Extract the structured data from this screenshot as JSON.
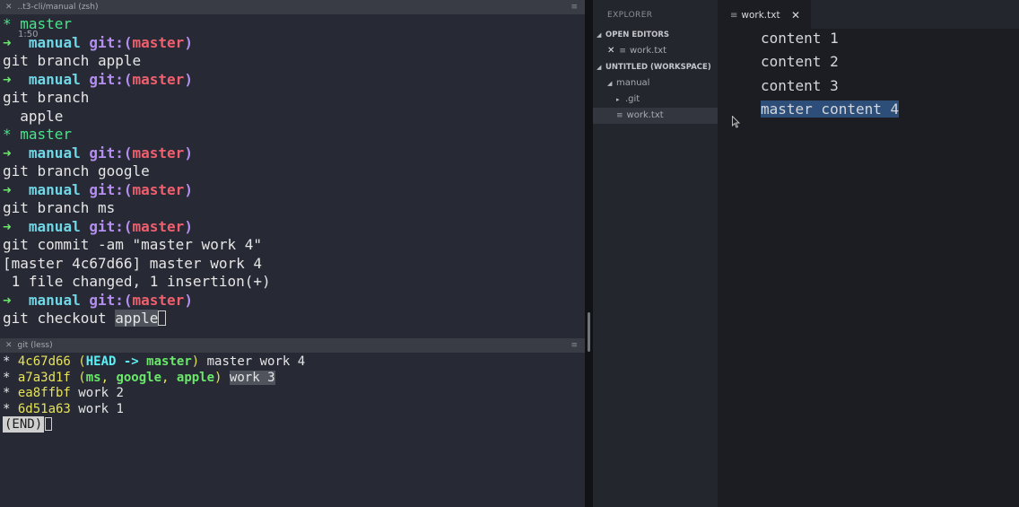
{
  "terminal_top": {
    "title": "..t3-cli/manual (zsh)",
    "time_overlay": "1:50",
    "lines": [
      [
        {
          "t": "* master",
          "c": "c-green"
        }
      ],
      [
        {
          "t": "➜  ",
          "c": "c-lime"
        },
        {
          "t": "manual ",
          "c": "c-cyan"
        },
        {
          "t": "git:(",
          "c": "c-purple"
        },
        {
          "t": "master",
          "c": "c-red"
        },
        {
          "t": ")",
          "c": "c-purple"
        }
      ],
      [
        {
          "t": "git branch apple",
          "c": ""
        }
      ],
      [
        {
          "t": "➜  ",
          "c": "c-lime"
        },
        {
          "t": "manual ",
          "c": "c-cyan"
        },
        {
          "t": "git:(",
          "c": "c-purple"
        },
        {
          "t": "master",
          "c": "c-red"
        },
        {
          "t": ")",
          "c": "c-purple"
        }
      ],
      [
        {
          "t": "git branch",
          "c": ""
        }
      ],
      [
        {
          "t": "  apple",
          "c": ""
        }
      ],
      [
        {
          "t": "* master",
          "c": "c-green"
        }
      ],
      [
        {
          "t": "➜  ",
          "c": "c-lime"
        },
        {
          "t": "manual ",
          "c": "c-cyan"
        },
        {
          "t": "git:(",
          "c": "c-purple"
        },
        {
          "t": "master",
          "c": "c-red"
        },
        {
          "t": ")",
          "c": "c-purple"
        }
      ],
      [
        {
          "t": "git branch google",
          "c": ""
        }
      ],
      [
        {
          "t": "➜  ",
          "c": "c-lime"
        },
        {
          "t": "manual ",
          "c": "c-cyan"
        },
        {
          "t": "git:(",
          "c": "c-purple"
        },
        {
          "t": "master",
          "c": "c-red"
        },
        {
          "t": ")",
          "c": "c-purple"
        }
      ],
      [
        {
          "t": "git branch ms",
          "c": ""
        }
      ],
      [
        {
          "t": "➜  ",
          "c": "c-lime"
        },
        {
          "t": "manual ",
          "c": "c-cyan"
        },
        {
          "t": "git:(",
          "c": "c-purple"
        },
        {
          "t": "master",
          "c": "c-red"
        },
        {
          "t": ")",
          "c": "c-purple"
        }
      ],
      [
        {
          "t": "git commit -am \"master work 4\"",
          "c": ""
        }
      ],
      [
        {
          "t": "[master 4c67d66] master work 4",
          "c": ""
        }
      ],
      [
        {
          "t": " 1 file changed, 1 insertion(+)",
          "c": ""
        }
      ],
      [
        {
          "t": "➜  ",
          "c": "c-lime"
        },
        {
          "t": "manual ",
          "c": "c-cyan"
        },
        {
          "t": "git:(",
          "c": "c-purple"
        },
        {
          "t": "master",
          "c": "c-red"
        },
        {
          "t": ")",
          "c": "c-purple"
        }
      ],
      [
        {
          "t": "git checkout ",
          "c": ""
        },
        {
          "t": "apple",
          "c": "sel-bg"
        },
        {
          "cursor": true
        }
      ]
    ]
  },
  "terminal_bottom": {
    "title": "git (less)",
    "lines": [
      [
        {
          "t": "* ",
          "c": ""
        },
        {
          "t": "4c67d66",
          "c": "c-yellow"
        },
        {
          "t": " (",
          "c": "c-yellow"
        },
        {
          "t": "HEAD -> ",
          "c": "c-bright"
        },
        {
          "t": "master",
          "c": "c-lime"
        },
        {
          "t": ")",
          "c": "c-yellow"
        },
        {
          "t": " master work 4",
          "c": ""
        }
      ],
      [
        {
          "t": "* ",
          "c": ""
        },
        {
          "t": "a7a3d1f",
          "c": "c-yellow"
        },
        {
          "t": " (",
          "c": "c-yellow"
        },
        {
          "t": "ms",
          "c": "c-lime"
        },
        {
          "t": ", ",
          "c": "c-yellow"
        },
        {
          "t": "google",
          "c": "c-lime"
        },
        {
          "t": ", ",
          "c": "c-yellow"
        },
        {
          "t": "apple",
          "c": "c-lime"
        },
        {
          "t": ")",
          "c": "c-yellow"
        },
        {
          "t": " ",
          "c": ""
        },
        {
          "t": "work 3",
          "c": "sel-bg"
        }
      ],
      [
        {
          "t": "* ",
          "c": ""
        },
        {
          "t": "ea8ffbf",
          "c": "c-yellow"
        },
        {
          "t": " work 2",
          "c": ""
        }
      ],
      [
        {
          "t": "* ",
          "c": ""
        },
        {
          "t": "6d51a63",
          "c": "c-yellow"
        },
        {
          "t": " work 1",
          "c": ""
        }
      ],
      [
        {
          "end": "(END)"
        }
      ]
    ]
  },
  "explorer": {
    "title": "EXPLORER",
    "open_editors_label": "OPEN EDITORS",
    "open_file": "work.txt",
    "workspace_label": "UNTITLED (WORKSPACE)",
    "folder": "manual",
    "subfolder": ".git",
    "file": "work.txt"
  },
  "editor": {
    "tab_label": "work.txt",
    "lines": [
      "content 1",
      "content 2",
      "content 3",
      "master content 4"
    ]
  },
  "colors": {
    "terminal_bg": "#272935",
    "selection": "#2c4e79",
    "accent_green": "#4ae38a",
    "accent_red": "#ef5f6e"
  }
}
